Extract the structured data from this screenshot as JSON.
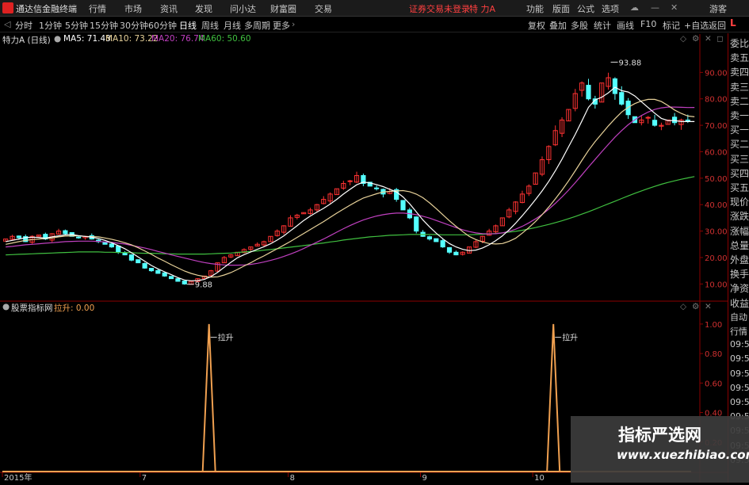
{
  "topbar": {
    "app_title": "通达信金融终端",
    "menu": [
      "行情",
      "市场",
      "资讯",
      "发现",
      "问小达",
      "财富圈",
      "交易"
    ],
    "notice": "证券交易未登录",
    "stock": "特 力A",
    "right_menu": [
      "功能",
      "版面",
      "公式",
      "选项"
    ],
    "guest": "游客"
  },
  "toolbar": {
    "periods": [
      "分时",
      "1分钟",
      "5分钟",
      "15分钟",
      "30分钟",
      "60分钟",
      "日线",
      "周线",
      "月线",
      "多周期",
      "更多"
    ],
    "active_period": "日线",
    "right_buttons": [
      "复权",
      "叠加",
      "多股",
      "统计",
      "画线",
      "F10",
      "标记",
      "+自选",
      "返回"
    ]
  },
  "legend": {
    "name": "特力A (日线)",
    "ma5": "MA5: 71.43",
    "ma10": "MA10: 73.22",
    "ma20": "MA20: 76.74",
    "ma60": "MA60: 50.60"
  },
  "indicator": {
    "name": "股票指标网",
    "value": "拉升: 0.00"
  },
  "right_panel": {
    "top": "L",
    "items": [
      "委比",
      "卖五",
      "卖四",
      "卖三",
      "卖二",
      "卖一",
      "买一",
      "买二",
      "买三",
      "买四",
      "买五",
      "现价",
      "涨跌",
      "涨幅",
      "总量",
      "外盘",
      "换手",
      "净资",
      "收益",
      "自动",
      "行情",
      "09:5",
      "09:5",
      "09:5",
      "09:5",
      "09:5",
      "09:5",
      "09:5",
      "09:5",
      "09:5"
    ]
  },
  "watermark": {
    "line1": "指标严选网",
    "line2": "www.xuezhibiao.com"
  },
  "colors": {
    "up": "#ff3232",
    "down": "#54ffff",
    "ma5": "#ffffff",
    "ma10": "#e8d29a",
    "ma20": "#c040c0",
    "ma60": "#40c040",
    "signal": "#f0a050",
    "axis": "#8b0000",
    "grid": "#8b0000"
  },
  "chart_data": [
    {
      "type": "candlestick",
      "title": "特力A (日线)",
      "y_ticks": [
        10,
        20,
        30,
        40,
        50,
        60,
        70,
        80,
        90
      ],
      "ylim": [
        5,
        100
      ],
      "x_labels": [
        "2015年",
        "7",
        "8",
        "9",
        "10"
      ],
      "annotations": [
        {
          "text": "93.88",
          "kind": "high"
        },
        {
          "text": "9.88",
          "kind": "low"
        }
      ],
      "closes": [
        27,
        28,
        27.5,
        26,
        28,
        28.5,
        27,
        29,
        30,
        29,
        28,
        27.5,
        28,
        27,
        26,
        25,
        24,
        22,
        21,
        19,
        18,
        16,
        15,
        14,
        13,
        12,
        11,
        10,
        11,
        12,
        13,
        15,
        18,
        20,
        21,
        22,
        23,
        24,
        25,
        26,
        28,
        30,
        32,
        35,
        36,
        37,
        38,
        40,
        42,
        44,
        46,
        48,
        49,
        51,
        48,
        47,
        46,
        44,
        45,
        42,
        38,
        35,
        30,
        28,
        27,
        26,
        24,
        22,
        21,
        22,
        24,
        26,
        28,
        30,
        32,
        35,
        38,
        41,
        44,
        47,
        52,
        57,
        62,
        68,
        72,
        76,
        82,
        86,
        80,
        78,
        86,
        88,
        82,
        78,
        74,
        71,
        72,
        73,
        70,
        70,
        72,
        71,
        72,
        71.4
      ],
      "ma5": [
        26,
        26.5,
        27,
        27.5,
        27.7,
        27.6,
        27.3,
        27.8,
        28.2,
        28.6,
        28.7,
        28.3,
        28,
        27.7,
        27.2,
        26.5,
        25.6,
        24.5,
        23.3,
        21.8,
        20.2,
        18.6,
        17,
        15.7,
        14.6,
        13.5,
        12.4,
        11.5,
        11.2,
        11.3,
        11.7,
        12.8,
        14.4,
        16.3,
        18.2,
        19.9,
        21.1,
        22.1,
        23.1,
        24.1,
        25.2,
        26.6,
        28.2,
        30.1,
        32,
        34,
        35.7,
        37.2,
        38.6,
        40.2,
        42,
        44,
        45.8,
        47.5,
        48.5,
        48.2,
        47.6,
        46.8,
        45.8,
        44.8,
        42.9,
        40.3,
        37.3,
        34.2,
        31.6,
        29.2,
        27.1,
        25.3,
        24,
        23.1,
        22.6,
        22.8,
        23.6,
        24.8,
        26.4,
        28.2,
        30.4,
        33,
        35.8,
        38.8,
        41.9,
        45.2,
        48.8,
        52.8,
        57.2,
        61.9,
        66.6,
        71.6,
        76.8,
        79.6,
        80.6,
        82.3,
        84.4,
        83.1,
        82.6,
        81.1,
        78.9,
        76.7,
        74.6,
        72.6,
        71.8,
        71.8,
        71.4,
        71.4,
        71.4
      ],
      "ma10": [
        25,
        25.5,
        26,
        26.5,
        26.8,
        27,
        27.2,
        27.4,
        27.8,
        28.1,
        28.2,
        28.2,
        28,
        27.9,
        27.8,
        27.4,
        26.9,
        26.3,
        25.6,
        24.8,
        23.7,
        22.5,
        21.2,
        19.8,
        18.6,
        17.3,
        16.1,
        14.9,
        14,
        13.3,
        12.8,
        12.6,
        12.7,
        13.4,
        14.3,
        15.5,
        16.8,
        18,
        19.4,
        20.6,
        22,
        23.3,
        24.7,
        26.1,
        27.6,
        29.1,
        30.6,
        32.1,
        33.6,
        35.2,
        36.8,
        38.3,
        39.8,
        41.2,
        42.5,
        43.3,
        44.1,
        44.8,
        45,
        45.2,
        45.3,
        44.9,
        44,
        42.6,
        40.7,
        38.5,
        36.2,
        33.9,
        31.8,
        29.8,
        28,
        26.8,
        25.9,
        25.3,
        25.1,
        25.3,
        26.1,
        27.3,
        29.2,
        31.3,
        33.6,
        36.2,
        39.1,
        42.2,
        45.5,
        49,
        52.8,
        56.7,
        60.5,
        63.8,
        66.8,
        69.8,
        72.5,
        75,
        76.8,
        78.2,
        79.2,
        79.8,
        79.8,
        79,
        77.5,
        75.8,
        74.5,
        73.5,
        73.2
      ],
      "ma20": [
        24,
        24.2,
        24.5,
        24.8,
        25,
        25.2,
        25.4,
        25.6,
        25.8,
        26,
        26.1,
        26.2,
        26.2,
        26.2,
        26.1,
        25.9,
        25.7,
        25.4,
        25.1,
        24.6,
        24.1,
        23.6,
        23,
        22.3,
        21.7,
        21,
        20.4,
        19.8,
        19.2,
        18.6,
        18.1,
        17.7,
        17.4,
        17.2,
        17.1,
        17.1,
        17.2,
        17.4,
        17.8,
        18.3,
        18.9,
        19.6,
        20.4,
        21.3,
        22.3,
        23.4,
        24.6,
        25.8,
        27,
        28.3,
        29.6,
        30.9,
        32.1,
        33.2,
        34.2,
        35,
        35.7,
        36.2,
        36.6,
        36.8,
        36.8,
        36.6,
        36.2,
        35.6,
        34.9,
        34,
        33.1,
        32.2,
        31.3,
        30.5,
        29.8,
        29.3,
        29,
        28.9,
        29,
        29.3,
        29.9,
        30.7,
        31.8,
        33.1,
        34.6,
        36.3,
        38.3,
        40.5,
        42.9,
        45.5,
        48.3,
        51.2,
        54.2,
        57.1,
        60,
        62.8,
        65.5,
        68,
        70.2,
        72.1,
        73.7,
        75,
        76,
        76.6,
        76.9,
        76.9,
        76.8,
        76.7,
        76.74
      ],
      "ma60": [
        21,
        21.1,
        21.2,
        21.3,
        21.4,
        21.5,
        21.6,
        21.7,
        21.8,
        21.9,
        22,
        22.1,
        22.1,
        22.1,
        22.1,
        22,
        22,
        21.9,
        21.9,
        21.8,
        21.7,
        21.6,
        21.6,
        21.5,
        21.4,
        21.4,
        21.3,
        21.3,
        21.3,
        21.3,
        21.3,
        21.4,
        21.5,
        21.6,
        21.7,
        21.9,
        22.1,
        22.3,
        22.5,
        22.8,
        23,
        23.3,
        23.6,
        23.9,
        24.2,
        24.5,
        24.8,
        25.2,
        25.5,
        25.9,
        26.2,
        26.6,
        26.9,
        27.2,
        27.5,
        27.8,
        28,
        28.2,
        28.4,
        28.5,
        28.6,
        28.7,
        28.7,
        28.7,
        28.7,
        28.7,
        28.6,
        28.6,
        28.6,
        28.6,
        28.6,
        28.7,
        28.8,
        28.9,
        29.1,
        29.3,
        29.6,
        29.9,
        30.3,
        30.8,
        31.3,
        31.9,
        32.5,
        33.2,
        33.9,
        34.7,
        35.5,
        36.4,
        37.3,
        38.3,
        39.3,
        40.3,
        41.3,
        42.3,
        43.3,
        44.3,
        45.2,
        46.1,
        46.9,
        47.7,
        48.4,
        49,
        49.6,
        50.1,
        50.6
      ]
    },
    {
      "type": "line",
      "title": "股票指标网",
      "series": [
        {
          "name": "拉升",
          "peaks": [
            0.3,
            0.8
          ],
          "peak_label": "拉升"
        }
      ],
      "y_ticks": [
        0.2,
        0.4,
        0.6,
        0.8,
        1.0
      ],
      "ylim": [
        0,
        1.08
      ]
    }
  ]
}
